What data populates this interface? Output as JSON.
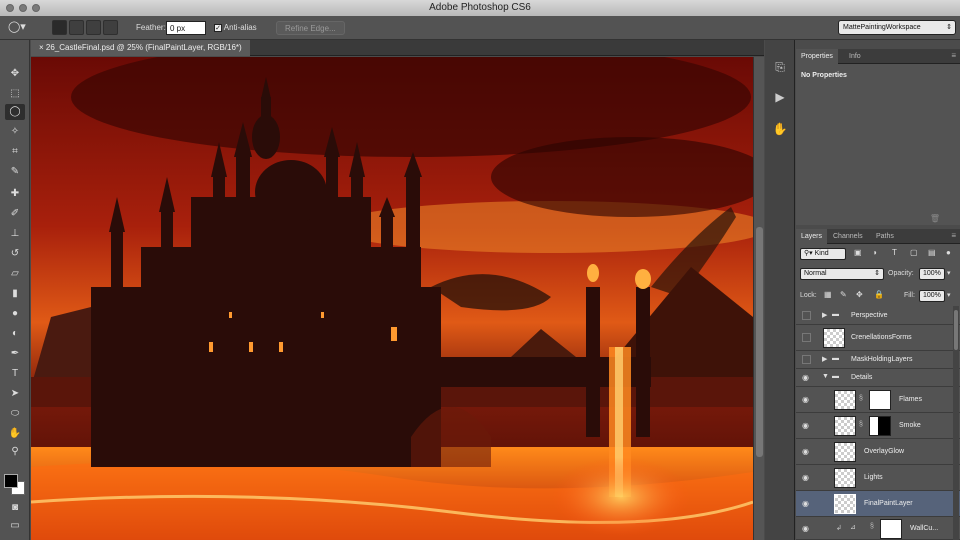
{
  "app": {
    "title": "Adobe Photoshop CS6"
  },
  "options": {
    "feather_label": "Feather:",
    "feather_value": "0 px",
    "antialias_label": "Anti-alias",
    "refine_edge_label": "Refine Edge...",
    "workspace": "MattePaintingWorkspace"
  },
  "document": {
    "tab_label": "26_CastleFinal.psd @ 25% (FinalPaintLayer, RGB/16*)"
  },
  "properties": {
    "tabs": [
      "Properties",
      "Info"
    ],
    "content": "No Properties"
  },
  "layers": {
    "tabs": [
      "Layers",
      "Channels",
      "Paths"
    ],
    "filter_kind": "Kind",
    "blend_mode": "Normal",
    "opacity_label": "Opacity:",
    "opacity_value": "100%",
    "lock_label": "Lock:",
    "fill_label": "Fill:",
    "fill_value": "100%",
    "items": [
      {
        "name": "Perspective"
      },
      {
        "name": "CrenellationsForms"
      },
      {
        "name": "MaskHoldingLayers"
      },
      {
        "name": "Details"
      },
      {
        "name": "Flames"
      },
      {
        "name": "Smoke"
      },
      {
        "name": "OverlayGlow"
      },
      {
        "name": "Lights"
      },
      {
        "name": "FinalPaintLayer"
      },
      {
        "name": "WallCu..."
      }
    ]
  },
  "colors": {
    "accent_selected": "#56637a",
    "foreground": "#000000",
    "background": "#ffffff"
  }
}
